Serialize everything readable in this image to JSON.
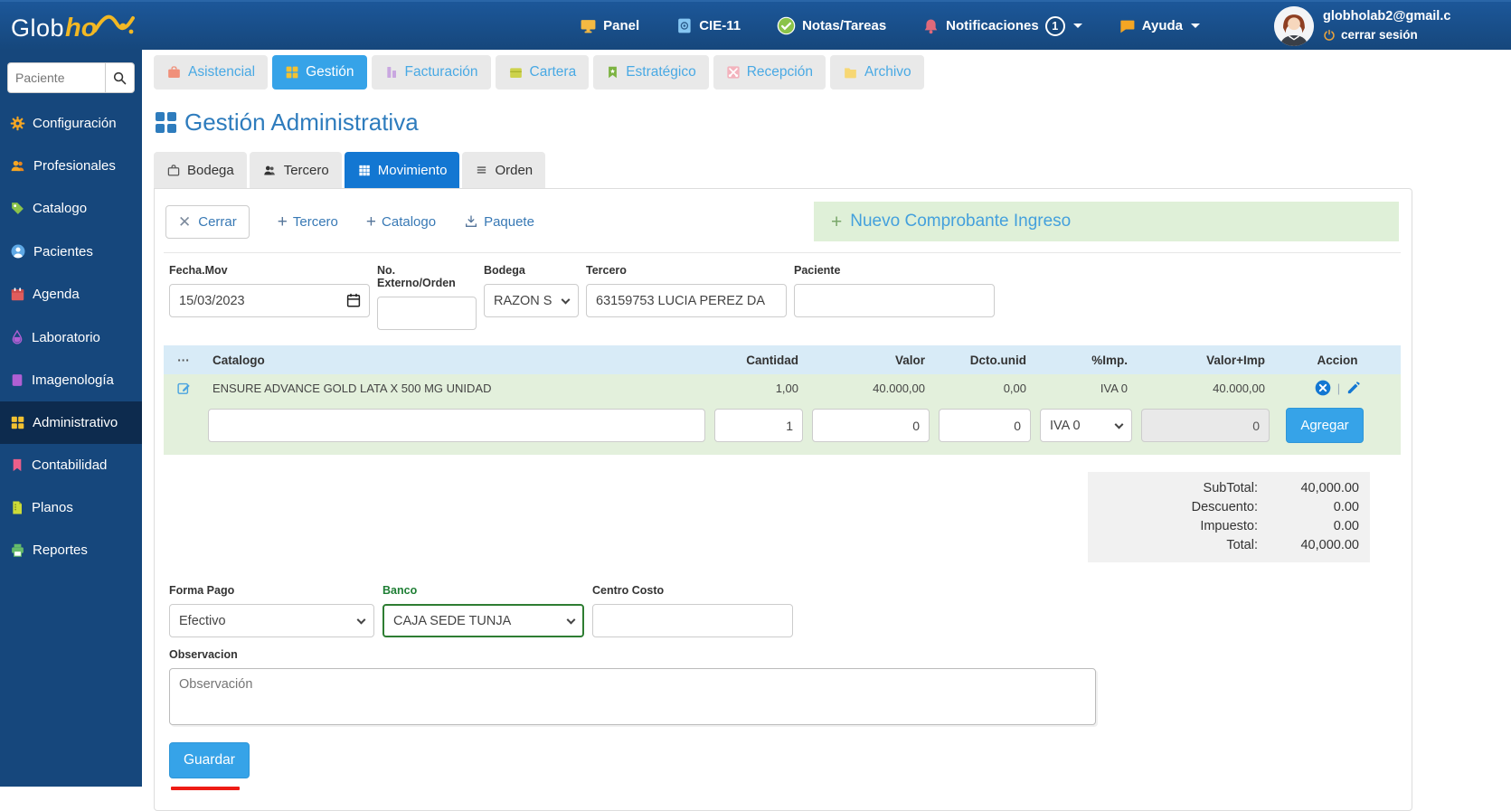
{
  "colors": {
    "navbar_blue": "#16477c",
    "active_tab_blue": "#36a3e8",
    "subtab_active_blue": "#1377d2",
    "banner_green_bg": "#dff0d8",
    "table_header_bg": "#d8ebf7",
    "row_green_bg": "#e3f0dc",
    "banco_border_green": "#2e7d32",
    "guardar_underline_red": "#ee1c15"
  },
  "brand": {
    "name_primary": "Glob",
    "name_accent": "ho"
  },
  "topnav": {
    "panel": "Panel",
    "cie": "CIE-11",
    "notas": "Notas/Tareas",
    "notificaciones": "Notificaciones",
    "notificaciones_badge": "1",
    "ayuda": "Ayuda",
    "user_email": "globholab2@gmail.c",
    "logout": "cerrar sesión"
  },
  "sidebar": {
    "search_placeholder": "Paciente",
    "items": [
      {
        "label": "Configuración",
        "icon": "gear-icon"
      },
      {
        "label": "Profesionales",
        "icon": "people-icon"
      },
      {
        "label": "Catalogo",
        "icon": "tag-icon"
      },
      {
        "label": "Pacientes",
        "icon": "patient-icon"
      },
      {
        "label": "Agenda",
        "icon": "calendar-icon"
      },
      {
        "label": "Laboratorio",
        "icon": "droplet-icon"
      },
      {
        "label": "Imagenología",
        "icon": "image-icon"
      },
      {
        "label": "Administrativo",
        "icon": "grid-icon"
      },
      {
        "label": "Contabilidad",
        "icon": "bookmark-icon"
      },
      {
        "label": "Planos",
        "icon": "file-icon"
      },
      {
        "label": "Reportes",
        "icon": "printer-icon"
      }
    ]
  },
  "module_tabs": [
    {
      "label": "Asistencial",
      "icon": "briefcase-icon"
    },
    {
      "label": "Gestión",
      "icon": "grid-icon"
    },
    {
      "label": "Facturación",
      "icon": "bars-icon"
    },
    {
      "label": "Cartera",
      "icon": "briefcase-icon"
    },
    {
      "label": "Estratégico",
      "icon": "bookmark-star-icon"
    },
    {
      "label": "Recepción",
      "icon": "scissors-icon"
    },
    {
      "label": "Archivo",
      "icon": "folder-icon"
    }
  ],
  "page_title": "Gestión Administrativa",
  "sub_tabs": [
    {
      "label": "Bodega",
      "icon": "briefcase-outline-icon"
    },
    {
      "label": "Tercero",
      "icon": "people-icon"
    },
    {
      "label": "Movimiento",
      "icon": "table-grid-icon"
    },
    {
      "label": "Orden",
      "icon": "list-icon"
    }
  ],
  "toolbar": {
    "cerrar": "Cerrar",
    "tercero": "Tercero",
    "catalogo": "Catalogo",
    "paquete": "Paquete",
    "nuevo_comprobante": "Nuevo Comprobante Ingreso"
  },
  "form": {
    "fecha_label": "Fecha.Mov",
    "fecha_value": "15/03/2023",
    "externo_label": "No. Externo/Orden",
    "bodega_label": "Bodega",
    "bodega_value": "RAZON S",
    "tercero_label": "Tercero",
    "tercero_value": "63159753 LUCIA PEREZ DA",
    "paciente_label": "Paciente"
  },
  "table": {
    "headers": {
      "menu": "···",
      "catalogo": "Catalogo",
      "cantidad": "Cantidad",
      "valor": "Valor",
      "dcto": "Dcto.unid",
      "imp": "%Imp.",
      "valor_imp": "Valor+Imp",
      "accion": "Accion"
    },
    "row": {
      "catalogo": "ENSURE ADVANCE GOLD LATA X 500 MG UNIDAD",
      "cantidad": "1,00",
      "valor": "40.000,00",
      "dcto": "0,00",
      "imp": "IVA 0",
      "valor_imp": "40.000,00"
    },
    "input_row": {
      "cantidad": "1",
      "valor": "0",
      "dcto": "0",
      "imp": "IVA 0",
      "valor_imp": "0",
      "agregar": "Agregar"
    }
  },
  "totals": {
    "subtotal_label": "SubTotal:",
    "subtotal_value": "40,000.00",
    "descuento_label": "Descuento:",
    "descuento_value": "0.00",
    "impuesto_label": "Impuesto:",
    "impuesto_value": "0.00",
    "total_label": "Total:",
    "total_value": "40,000.00"
  },
  "payment": {
    "forma_pago_label": "Forma Pago",
    "forma_pago_value": "Efectivo",
    "banco_label": "Banco",
    "banco_value": "CAJA SEDE TUNJA",
    "centro_costo_label": "Centro Costo"
  },
  "observacion": {
    "label": "Observacion",
    "placeholder": "Observación"
  },
  "guardar": "Guardar"
}
